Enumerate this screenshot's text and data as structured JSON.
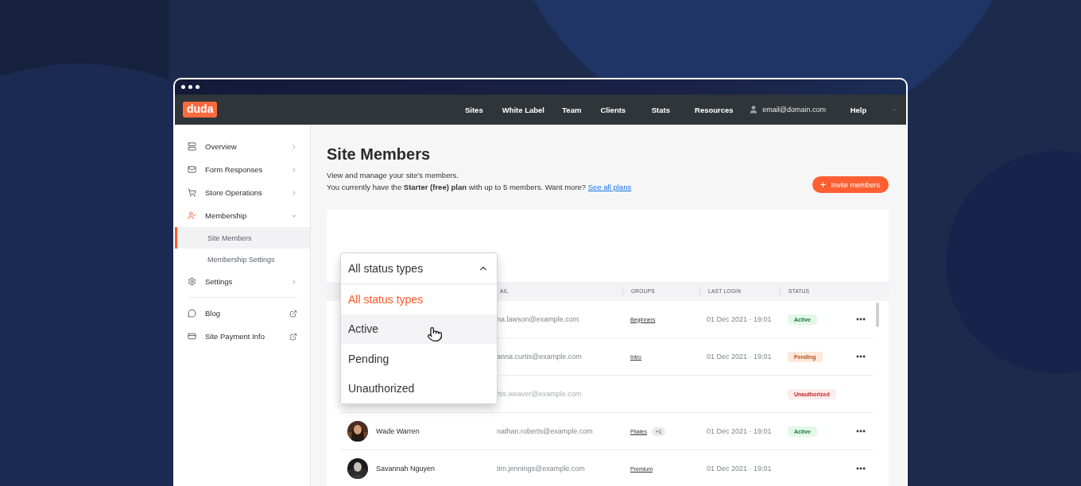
{
  "nav": {
    "logo": "duda",
    "items": [
      "Sites",
      "White Label",
      "Team",
      "Clients",
      "Stats",
      "Resources"
    ],
    "account": "email@domain.com",
    "help": "Help"
  },
  "sidebar": {
    "sections": [
      {
        "items": [
          {
            "label": "Overview",
            "kind": "section",
            "expanded": false
          },
          {
            "label": "Form Responses",
            "kind": "section",
            "expanded": false
          },
          {
            "label": "Store Operations",
            "kind": "section",
            "expanded": false
          },
          {
            "label": "Membership",
            "kind": "section",
            "expanded": true,
            "children": [
              {
                "label": "Site Members",
                "selected": true
              },
              {
                "label": "Membership Settings",
                "selected": false
              }
            ]
          },
          {
            "label": "Settings",
            "kind": "section",
            "expanded": false
          }
        ]
      },
      {
        "items": [
          {
            "label": "Blog",
            "kind": "external"
          },
          {
            "label": "Site Payment Info",
            "kind": "external"
          }
        ]
      }
    ]
  },
  "page": {
    "title": "Site Members",
    "description": "View and manage your site’s members.",
    "plan_text": "You currently have the **Starter (free) plan** with up to 5 members. Want more?",
    "plan_link": "See all plans",
    "invite_button": "Invite members"
  },
  "filter": {
    "value": "All status types",
    "expanded": true,
    "options": [
      {
        "label": "All status types",
        "selected": true,
        "highlighted": false
      },
      {
        "label": "Active",
        "selected": false,
        "highlighted": true
      },
      {
        "label": "Pending",
        "selected": false,
        "highlighted": false
      },
      {
        "label": "Unauthorized",
        "selected": false,
        "highlighted": false
      }
    ]
  },
  "table": {
    "columns": [
      "AIL",
      "GROUPS",
      "LAST LOGIN",
      "STATUS"
    ],
    "rows": [
      {
        "email": "na.lawson@example.com",
        "groups": [
          "Beginners"
        ],
        "last_login": "01 Dec 2021 · 19:01",
        "status": {
          "label": "Active",
          "kind": "active"
        },
        "disabled": false,
        "menu": true
      },
      {
        "email": "anna.curtis@example.com",
        "groups": [
          "Intro"
        ],
        "last_login": "01 Dec 2021 · 19:01",
        "status": {
          "label": "Pending",
          "kind": "pending"
        },
        "disabled": false,
        "menu": true
      },
      {
        "email": "rtis.weaver@example.com",
        "status": {
          "label": "Unauthorized",
          "kind": "unauthorized"
        },
        "disabled": true,
        "menu": false
      },
      {
        "name": "Wade Warren",
        "avatar": {
          "kind": "picture"
        },
        "email": "nathan.roberts@example.com",
        "groups": [
          "Pilates"
        ],
        "more_groups": "+1",
        "last_login": "01 Dec 2021 · 19:01",
        "status": {
          "label": "Active",
          "kind": "active"
        },
        "disabled": false,
        "menu": true
      },
      {
        "name": "Savannah Nguyen",
        "avatar": {
          "kind": "picture"
        },
        "email": "tim.jennings@example.com",
        "groups": [
          "Premium"
        ],
        "last_login": "01 Dec 2021 · 19:01",
        "disabled": false,
        "menu": true
      }
    ]
  }
}
